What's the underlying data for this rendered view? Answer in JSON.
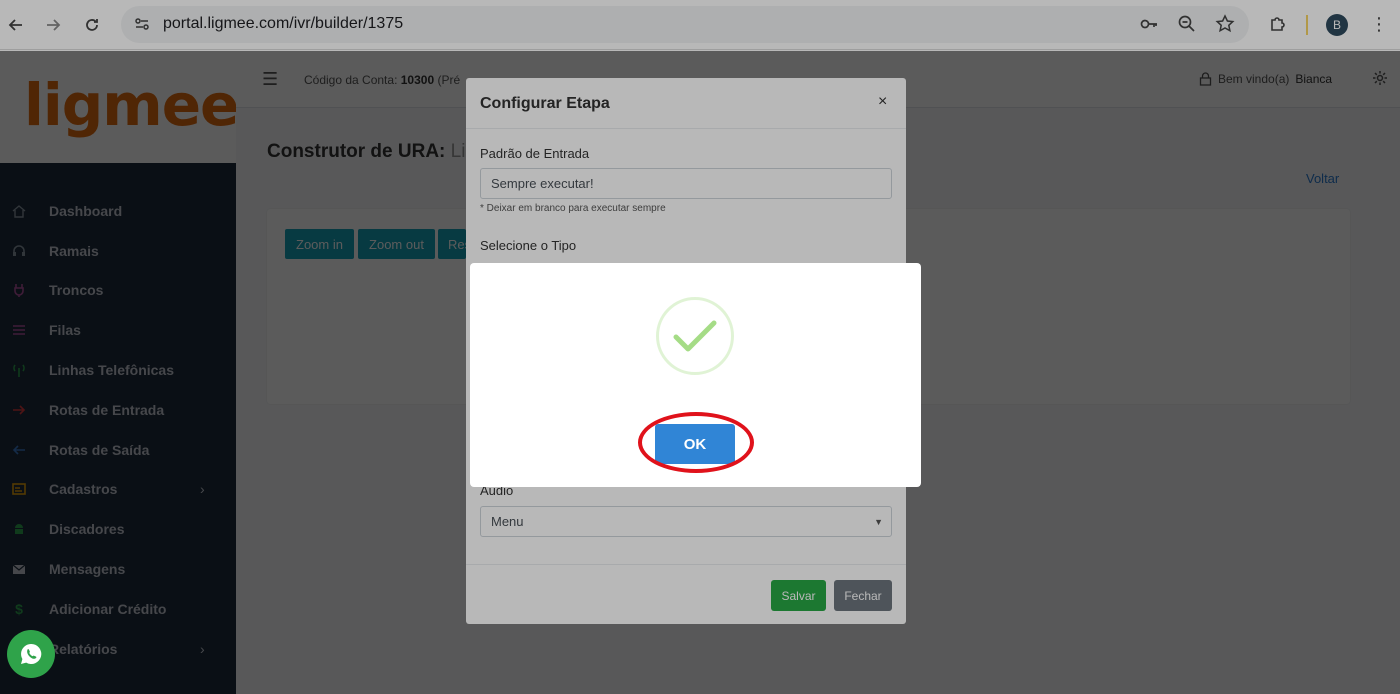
{
  "browser": {
    "url": "portal.ligmee.com/ivr/builder/1375",
    "profile_initial": "B"
  },
  "sidebar": {
    "logo": "ligmee",
    "items": [
      {
        "label": "Dashboard",
        "icon": "home-icon",
        "color": "#8a96a3"
      },
      {
        "label": "Ramais",
        "icon": "headset-icon",
        "color": "#8a96a3"
      },
      {
        "label": "Troncos",
        "icon": "plug-icon",
        "color": "#b0509c"
      },
      {
        "label": "Filas",
        "icon": "list-icon",
        "color": "#b0509c"
      },
      {
        "label": "Linhas Telefônicas",
        "icon": "antenna-icon",
        "color": "#2ea44f"
      },
      {
        "label": "Rotas de Entrada",
        "icon": "arrow-right-icon",
        "color": "#d9393d"
      },
      {
        "label": "Rotas de Saída",
        "icon": "arrow-left-icon",
        "color": "#3a78c9"
      },
      {
        "label": "Cadastros",
        "icon": "id-card-icon",
        "color": "#e6a10a",
        "caret": true
      },
      {
        "label": "Discadores",
        "icon": "android-icon",
        "color": "#2ea44f"
      },
      {
        "label": "Mensagens",
        "icon": "envelope-icon",
        "color": "#c2c7d0"
      },
      {
        "label": "Adicionar Crédito",
        "icon": "dollar-icon",
        "color": "#2ea44f"
      },
      {
        "label": "Relatórios",
        "icon": "chart-icon",
        "color": "#c2c7d0",
        "caret": true
      }
    ]
  },
  "topbar": {
    "account_label": "Código da Conta:",
    "account_number": "10300",
    "account_rest": "(Pré",
    "welcome_label": "Bem vindo(a)",
    "welcome_name": "Bianca"
  },
  "main": {
    "title": "Construtor de URA:",
    "title_sub": "Lig",
    "back_link": "Voltar",
    "zoom_in": "Zoom in",
    "zoom_out": "Zoom out",
    "reset": "Res"
  },
  "modal": {
    "title": "Configurar Etapa",
    "close": "×",
    "input_label": "Padrão de Entrada",
    "input_value": "Sempre executar!",
    "hint": "* Deixar em branco para executar sempre",
    "type_label": "Selecione o Tipo",
    "audio_label": "Áudio",
    "audio_value": "Menu",
    "save": "Salvar",
    "close_button": "Fechar"
  },
  "alert": {
    "ok_label": "OK"
  },
  "colors": {
    "save": "#28a745",
    "close": "#6c757d",
    "ok": "#3085d6",
    "success": "#a5dc86",
    "highlight": "#e0121b"
  }
}
